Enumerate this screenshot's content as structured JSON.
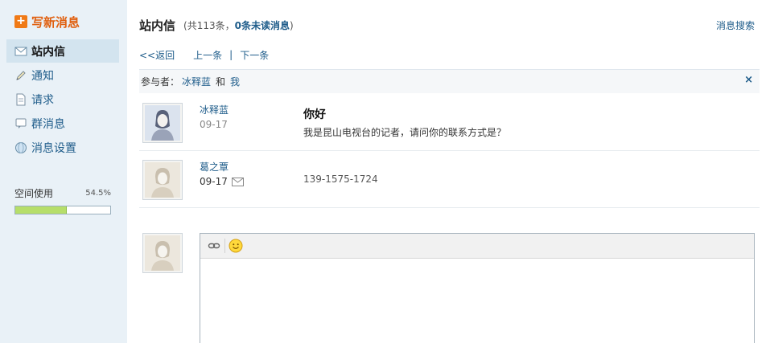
{
  "sidebar": {
    "compose_label": "写新消息",
    "items": [
      {
        "label": "站内信",
        "icon": "envelope-icon",
        "active": true
      },
      {
        "label": "通知",
        "icon": "pencil-icon",
        "active": false
      },
      {
        "label": "请求",
        "icon": "document-icon",
        "active": false
      },
      {
        "label": "群消息",
        "icon": "chat-bubble-icon",
        "active": false
      },
      {
        "label": "消息设置",
        "icon": "globe-settings-icon",
        "active": false
      }
    ],
    "space": {
      "label": "空间使用",
      "percent_text": "54.5%",
      "fill_fraction": 0.545
    }
  },
  "header": {
    "title": "站内信",
    "count_open": "(共113条，",
    "unread_text": "0条未读消息",
    "count_close": ")",
    "search_link": "消息搜索"
  },
  "toolbar": {
    "back": "<<返回",
    "prev": "上一条",
    "separator": "|",
    "next": "下一条"
  },
  "participants": {
    "prefix": "参与者：",
    "user1": "冰释蓝",
    "conj": "和",
    "user2": "我",
    "close": "×"
  },
  "messages": [
    {
      "sender": "冰释蓝",
      "date": "09-17",
      "subject": "你好",
      "body": "我是昆山电视台的记者，请问你的联系方式是？"
    },
    {
      "sender": "葛之覃",
      "date": "09-17",
      "subject": "",
      "body": "139-1575-1724"
    }
  ],
  "colors": {
    "link": "#1e5c8a",
    "compose": "#e06010",
    "sidebar_bg": "#e9f1f7",
    "space_fill": "#b6de6a"
  }
}
